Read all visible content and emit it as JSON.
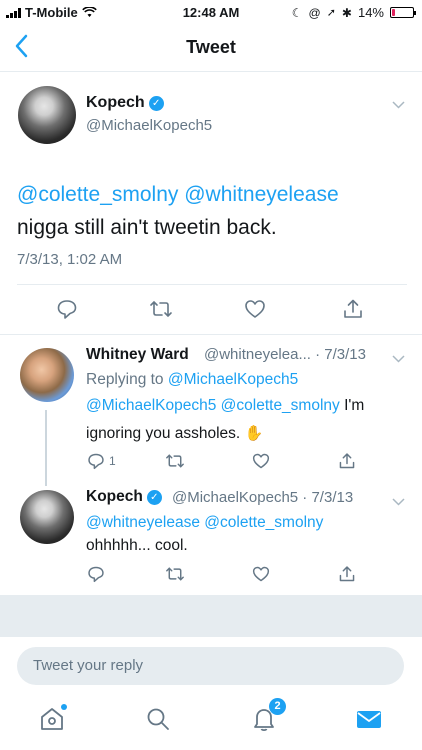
{
  "status_bar": {
    "carrier": "T-Mobile",
    "time": "12:48 AM",
    "battery": "14%",
    "battery_level": 0.14
  },
  "navbar": {
    "back": "<",
    "title": "Tweet"
  },
  "main_tweet": {
    "name": "Kopech",
    "handle": "@MichaelKopech5",
    "mention1": "@colette_smolny",
    "mention2": "@whitneyelease",
    "text": "nigga still ain't tweetin back.",
    "timestamp": "7/3/13, 1:02 AM"
  },
  "reply1": {
    "name": "Whitney Ward",
    "meta": "@whitneyelea... · 7/3/13",
    "replying_prefix": "Replying to",
    "replying_to": "@MichaelKopech5",
    "mention1": "@MichaelKopech5",
    "mention2": "@colette_smolny",
    "text_after": "I'm",
    "line2": "ignoring you assholes.",
    "emoji": "✋",
    "reply_count": "1"
  },
  "reply2": {
    "name": "Kopech",
    "meta": "@MichaelKopech5 · 7/3/13",
    "mention1": "@whitneyelease",
    "mention2": "@colette_smolny",
    "text": "ohhhhh... cool."
  },
  "composer": {
    "placeholder": "Tweet your reply"
  },
  "tabbar": {
    "notifications_badge": "2"
  },
  "colors": {
    "accent": "#1da1f2",
    "muted": "#657786",
    "text": "#14171a",
    "divider": "#e6ecf0"
  },
  "icons": [
    "wifi-icon",
    "battery-icon",
    "back-chevron-icon",
    "verified-icon",
    "chevron-down-icon",
    "reply-icon",
    "retweet-icon",
    "like-icon",
    "share-icon",
    "home-icon",
    "search-icon",
    "notifications-icon",
    "messages-icon"
  ]
}
